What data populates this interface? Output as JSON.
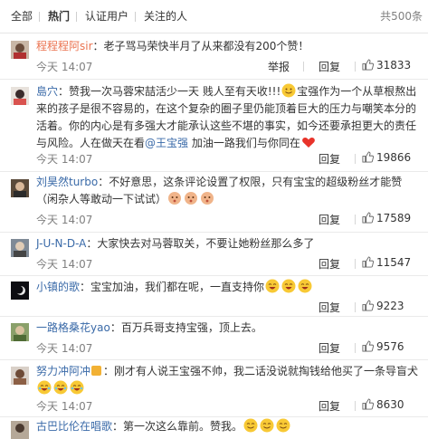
{
  "tabs": [
    {
      "label": "全部",
      "active": false
    },
    {
      "label": "热门",
      "active": true
    },
    {
      "label": "认证用户",
      "active": false
    },
    {
      "label": "关注的人",
      "active": false
    }
  ],
  "total_count": "共500条",
  "actions": {
    "report": "举报",
    "reply": "回复"
  },
  "comments": [
    {
      "user": "程程程阿sir",
      "text": "：老子骂马荣快半月了从来都没有200个赞！",
      "time": "今天 14:07",
      "likes": "31833"
    },
    {
      "user": "島穴",
      "text1": "：赞我一次马蓉宋喆活少一天 贱人至有天收!!!",
      "text2": "宝强作为一个从草根熬出来的孩子是很不容易的，在这个复杂的圈子里仍能顶着巨大的压力与嘲笑本分的活着。你的内心是有多强大才能承认这些不堪的事实，如今还要承担更大的责任与风险。人在做天在看",
      "mention": "@王宝强",
      "text3": " 加油一路我们与你同在",
      "time": "今天 14:07",
      "likes": "19866"
    },
    {
      "user": "刘昊然turbo",
      "text": "：不好意思，这条评论设置了权限，只有宝宝的超级粉丝才能赞（闲杂人等敢动一下试试）",
      "time": "今天 14:07",
      "likes": "17589"
    },
    {
      "user": "J-U-N-D-A",
      "text": "：大家快去对马蓉取关，不要让她粉丝那么多了",
      "time": "今天 14:07",
      "likes": "11547"
    },
    {
      "user": "小镇的歌",
      "text": "：宝宝加油，我们都在呢，一直支持你",
      "time": "今天 14:07",
      "likes": "9223"
    },
    {
      "user": "一路格桑花yao",
      "text": "：百万兵哥支持宝强，顶上去。",
      "time": "今天 14:07",
      "likes": "9576"
    },
    {
      "user": "努力冲阿冲",
      "text": "：刚才有人说王宝强不帅，我二话没说就掏钱给他买了一条导盲犬",
      "time": "今天 14:07",
      "likes": "8630"
    },
    {
      "user": "古巴比伦在唱歌",
      "text": "：第一次这么靠前。赞我。"
    }
  ],
  "colors": {
    "username": "#eb7350",
    "link": "#3a6aa8",
    "muted": "#808080"
  }
}
